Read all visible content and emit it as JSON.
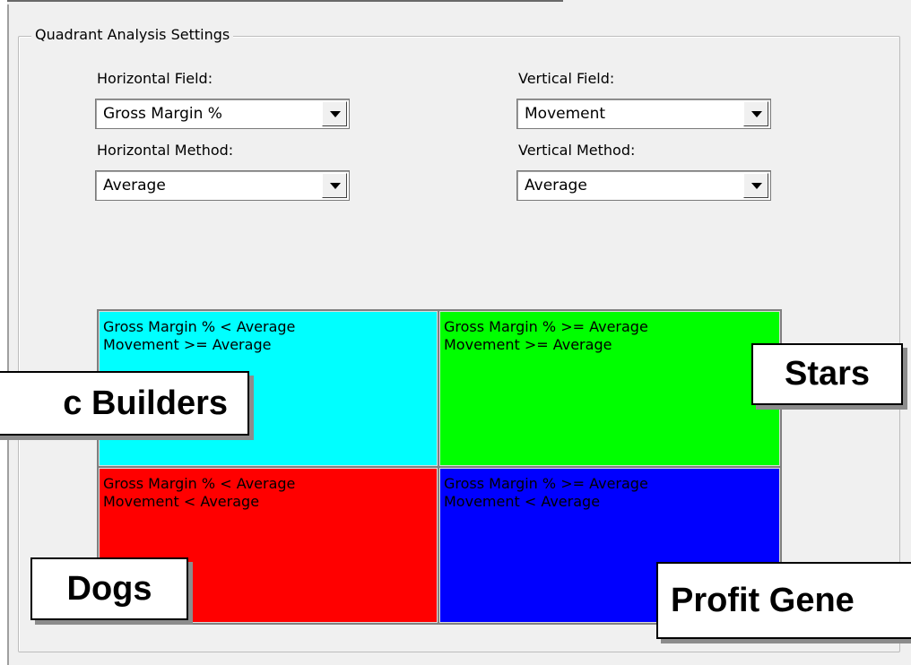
{
  "group": {
    "title": "Quadrant Analysis Settings"
  },
  "horizontal_field": {
    "label": "Horizontal Field:",
    "value": "Gross Margin %"
  },
  "vertical_field": {
    "label": "Vertical Field:",
    "value": "Movement"
  },
  "horizontal_method": {
    "label": "Horizontal Method:",
    "value": "Average"
  },
  "vertical_method": {
    "label": "Vertical Method:",
    "value": "Average"
  },
  "quadrants": {
    "top_left": {
      "line1": "Gross Margin % < Average",
      "line2": "Movement >= Average",
      "color": "#00ffff"
    },
    "top_right": {
      "line1": "Gross Margin % >= Average",
      "line2": "Movement >= Average",
      "color": "#00ff00"
    },
    "bottom_left": {
      "line1": "Gross Margin % < Average",
      "line2": "Movement < Average",
      "color": "#ff0000"
    },
    "bottom_right": {
      "line1": "Gross Margin % >= Average",
      "line2": "Movement < Average",
      "color": "#0000ff"
    }
  },
  "callouts": {
    "stars": "Stars",
    "builders": "c Builders",
    "dogs": "Dogs",
    "profit": "Profit Gene"
  }
}
